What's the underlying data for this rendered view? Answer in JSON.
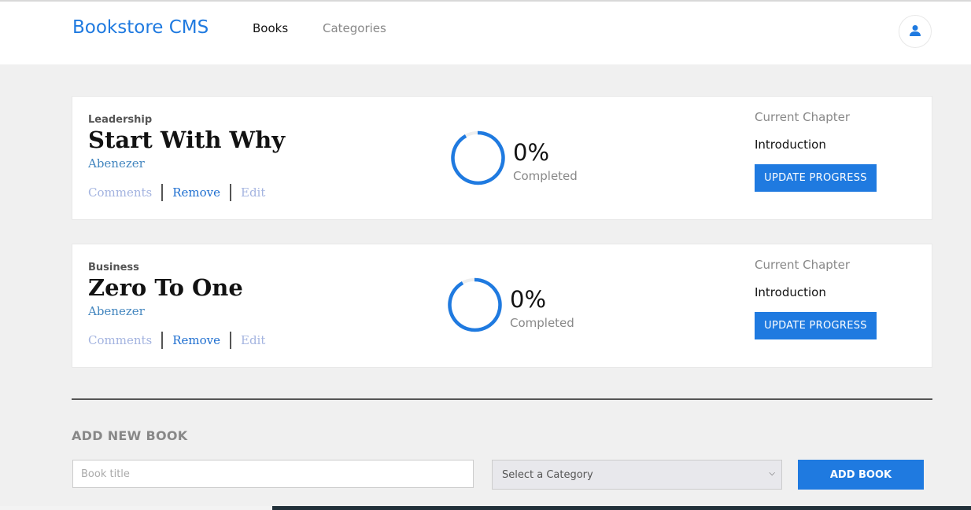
{
  "header": {
    "brand": "Bookstore CMS",
    "nav": {
      "books": "Books",
      "categories": "Categories"
    },
    "user_icon": "user-icon"
  },
  "books": [
    {
      "category": "Leadership",
      "title": "Start With Why",
      "author": "Abenezer",
      "actions": {
        "comments": "Comments",
        "remove": "Remove",
        "edit": "Edit"
      },
      "progress_percent": "0%",
      "progress_value": 0,
      "progress_label": "Completed",
      "chapter_label": "Current Chapter",
      "chapter_name": "Introduction",
      "update_button": "UPDATE PROGRESS"
    },
    {
      "category": "Business",
      "title": "Zero To One",
      "author": "Abenezer",
      "actions": {
        "comments": "Comments",
        "remove": "Remove",
        "edit": "Edit"
      },
      "progress_percent": "0%",
      "progress_value": 0,
      "progress_label": "Completed",
      "chapter_label": "Current Chapter",
      "chapter_name": "Introduction",
      "update_button": "UPDATE PROGRESS"
    }
  ],
  "add_form": {
    "heading": "ADD NEW BOOK",
    "title_placeholder": "Book title",
    "category_selected": "Select a Category",
    "submit": "ADD BOOK"
  },
  "colors": {
    "accent": "#1f7ae0",
    "background": "#f0f0f0"
  }
}
